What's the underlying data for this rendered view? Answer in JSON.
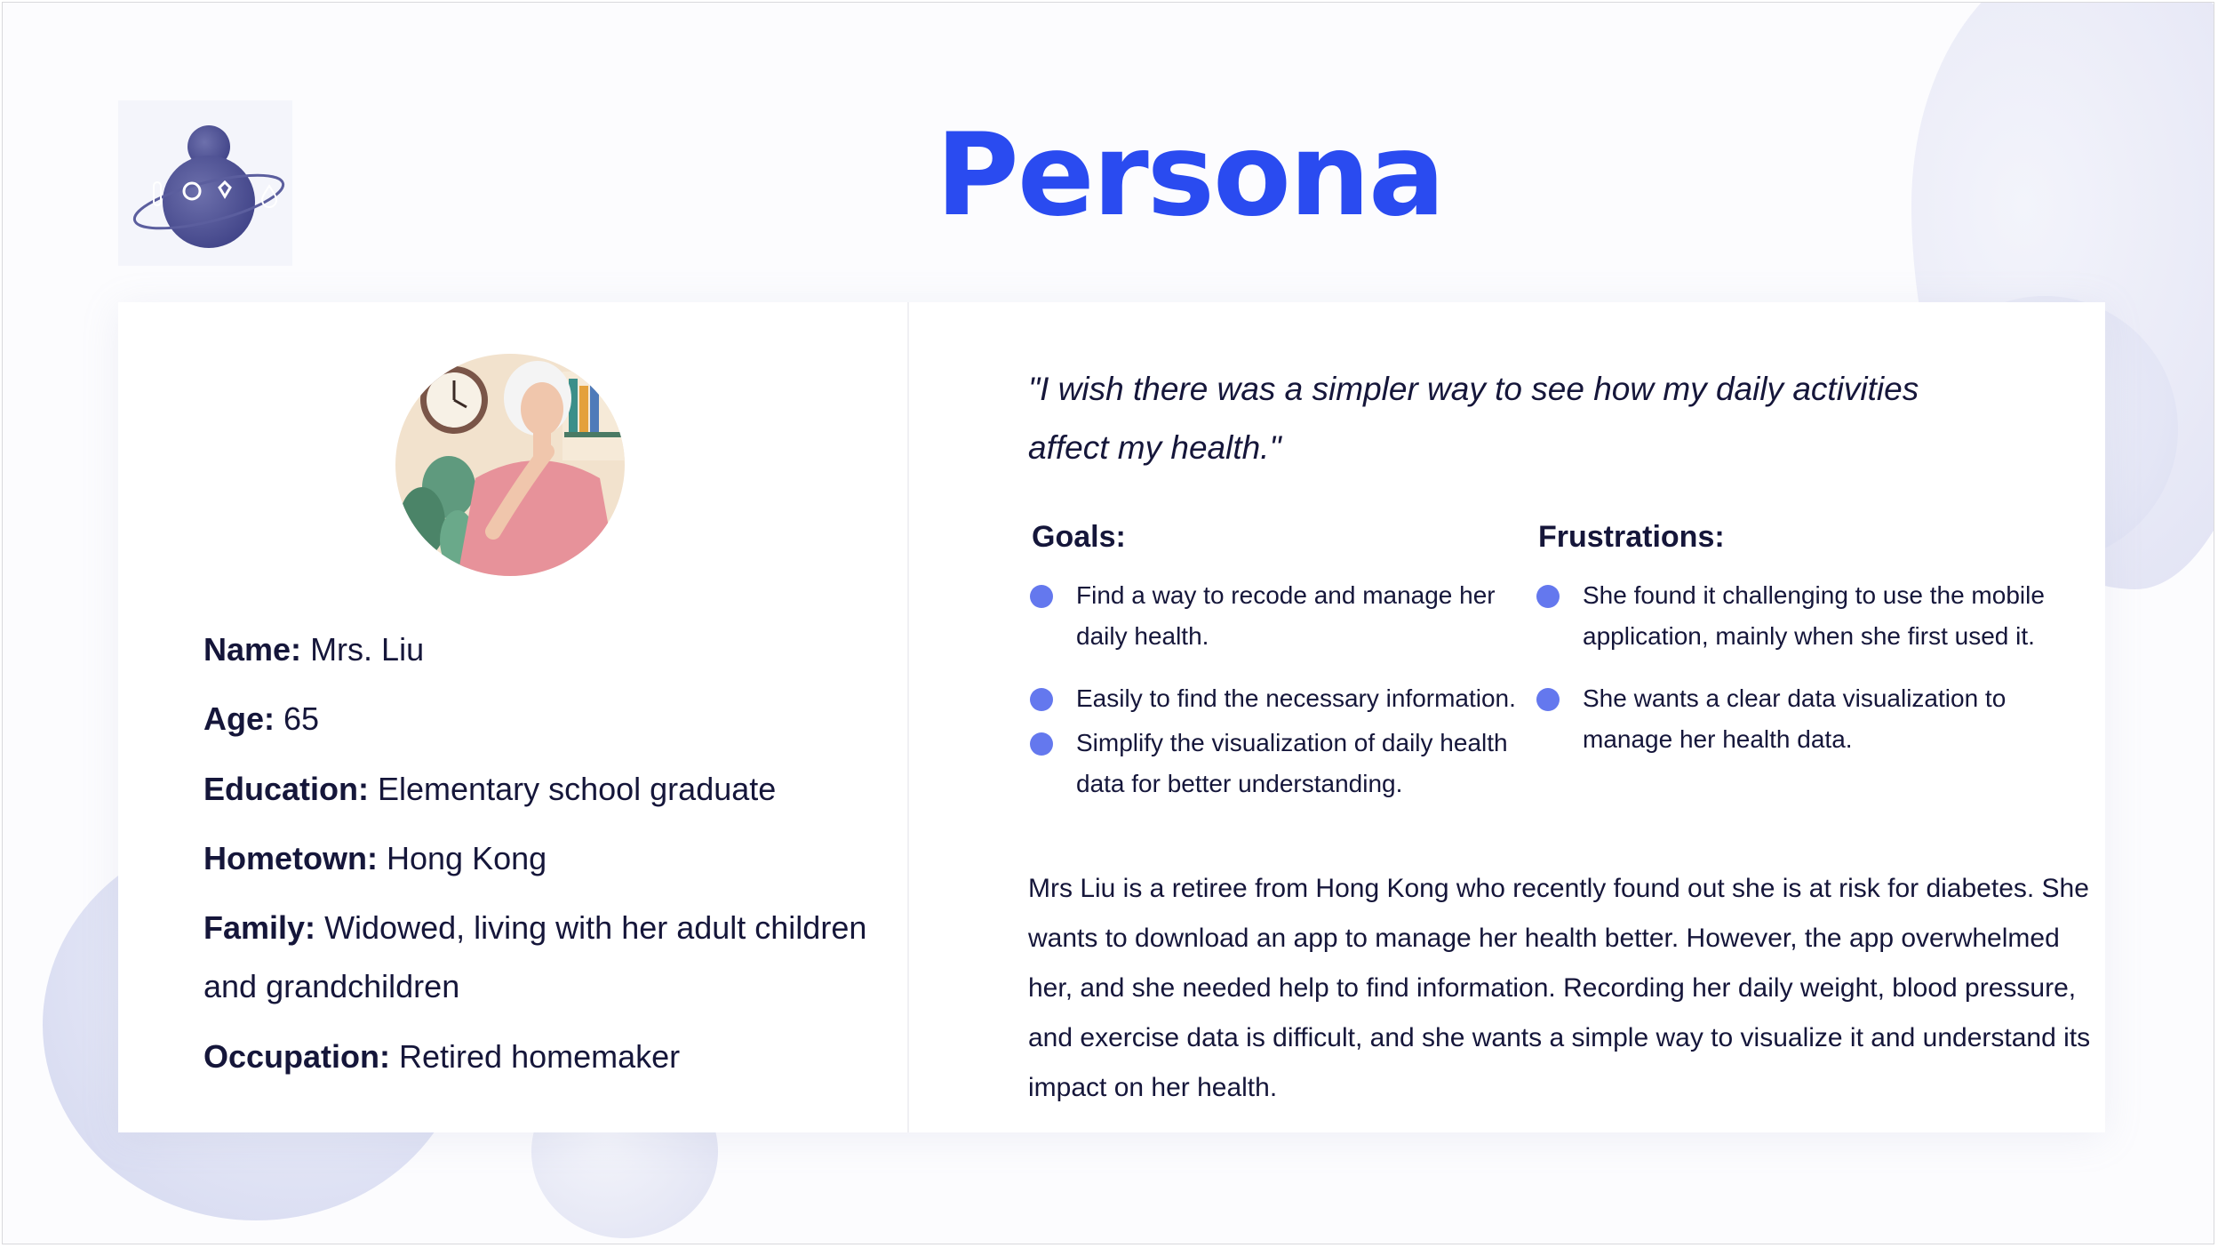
{
  "slide": {
    "title": "Persona"
  },
  "profile": {
    "name_label": "Name:",
    "name_value": "Mrs. Liu",
    "age_label": "Age:",
    "age_value": "65",
    "education_label": "Education:",
    "education_value": "Elementary school graduate",
    "hometown_label": "Hometown:",
    "hometown_value": "Hong Kong",
    "family_label": "Family:",
    "family_value": "Widowed, living with her adult children and grandchildren",
    "occupation_label": "Occupation:",
    "occupation_value": "Retired homemaker"
  },
  "quote": "\"I wish there was a simpler way to see how my daily activities affect my health.\"",
  "goals": {
    "heading": "Goals:",
    "items": [
      "Find a way to recode and manage her daily health.",
      "Easily to find the necessary information.",
      "Simplify the visualization of daily health data for better understanding."
    ]
  },
  "frustrations": {
    "heading": "Frustrations:",
    "items": [
      "She found it challenging to use the mobile application, mainly when she first used it.",
      "She wants a clear data visualization to manage her health data."
    ]
  },
  "bio": "Mrs Liu is a retiree from Hong Kong who recently found out she is at risk for diabetes. She wants to download an app to manage her health better. However, the app overwhelmed her, and she needed help to find information. Recording her daily weight, blood pressure, and exercise data is difficult, and she wants a simple way to visualize it and understand its impact on her health.",
  "icons": {
    "logo": "health-person-logo-icon",
    "avatar": "elderly-woman-avatar-icon"
  },
  "colors": {
    "accent": "#2a4bf0",
    "bullet": "#6478ee",
    "text": "#15163a",
    "logo": "#4c4f8f"
  }
}
